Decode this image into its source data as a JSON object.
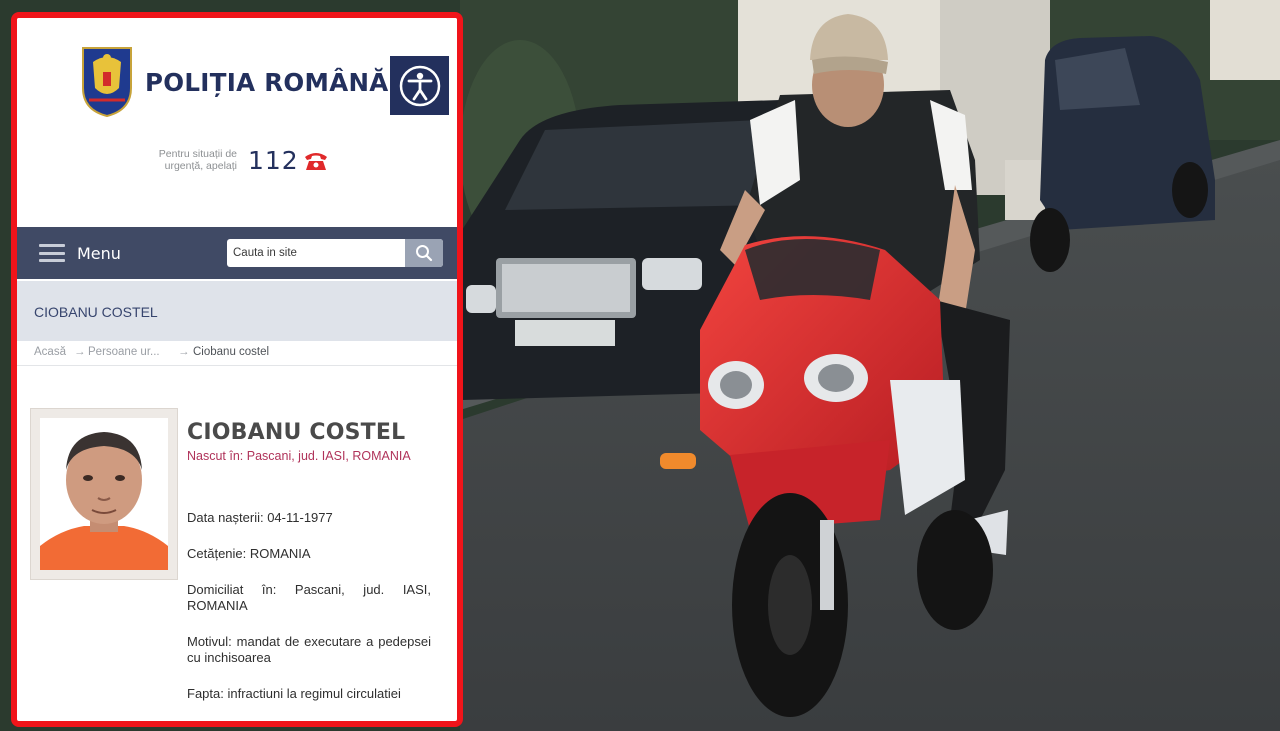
{
  "site": {
    "title": "POLIȚIA ROMÂNĂ",
    "emergency_text": "Pentru situații de urgență, apelați",
    "emergency_number": "112"
  },
  "nav": {
    "menu_label": "Menu",
    "search_placeholder": "Cauta in site"
  },
  "page_title": "CIOBANU COSTEL",
  "breadcrumb": {
    "items": [
      "Acasă",
      "Persoane ur...",
      "Ciobanu costel"
    ],
    "separator": "→"
  },
  "person": {
    "name": "CIOBANU COSTEL",
    "born": "Nascut în: Pascani, jud. IASI, ROMANIA",
    "birth_date": "Data nașterii: 04-11-1977",
    "citizenship": "Cetățenie: ROMANIA",
    "domicile": "Domiciliat în: Pascani, jud. IASI, ROMANIA",
    "reason": "Motivul: mandat de executare a pedepsei cu inchisoarea",
    "offense": "Fapta: infractiuni la regimul circulatiei"
  },
  "icons": {
    "accessibility": "accessibility-icon",
    "phone": "phone-icon",
    "search": "search-icon",
    "menu": "hamburger-menu-icon",
    "crest": "romanian-police-crest-icon"
  },
  "colors": {
    "frame_red": "#f0141a",
    "navy": "#23305d",
    "navbar": "#404a65",
    "accent_magenta": "#b0335a"
  }
}
